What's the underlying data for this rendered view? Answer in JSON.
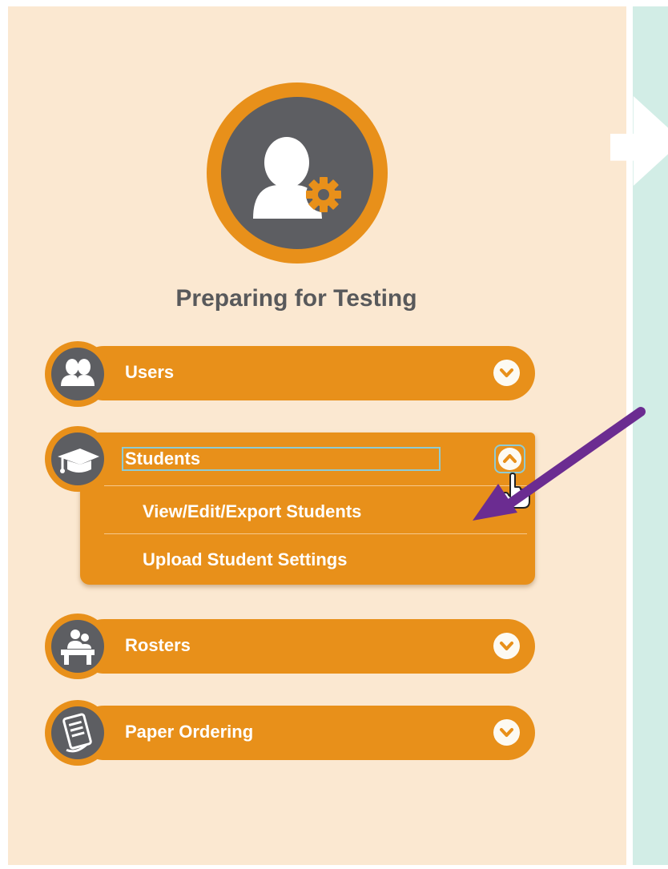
{
  "section": {
    "title": "Preparing for Testing",
    "icon": "user-gear-icon"
  },
  "menu": [
    {
      "id": "users",
      "label": "Users",
      "icon": "users-icon",
      "expanded": false
    },
    {
      "id": "students",
      "label": "Students",
      "icon": "graduation-cap-icon",
      "expanded": true,
      "subitems": [
        {
          "label": "View/Edit/Export Students"
        },
        {
          "label": "Upload Student Settings"
        }
      ]
    },
    {
      "id": "rosters",
      "label": "Rosters",
      "icon": "classroom-icon",
      "expanded": false
    },
    {
      "id": "paper-ordering",
      "label": "Paper Ordering",
      "icon": "paper-form-icon",
      "expanded": false
    }
  ],
  "colors": {
    "background": "#fbe8d1",
    "accent": "#e8901a",
    "icon_dark": "#5d5e62",
    "title_text": "#58595b",
    "right_panel": "#d2ede6",
    "annotation_arrow": "#6b2c91"
  }
}
